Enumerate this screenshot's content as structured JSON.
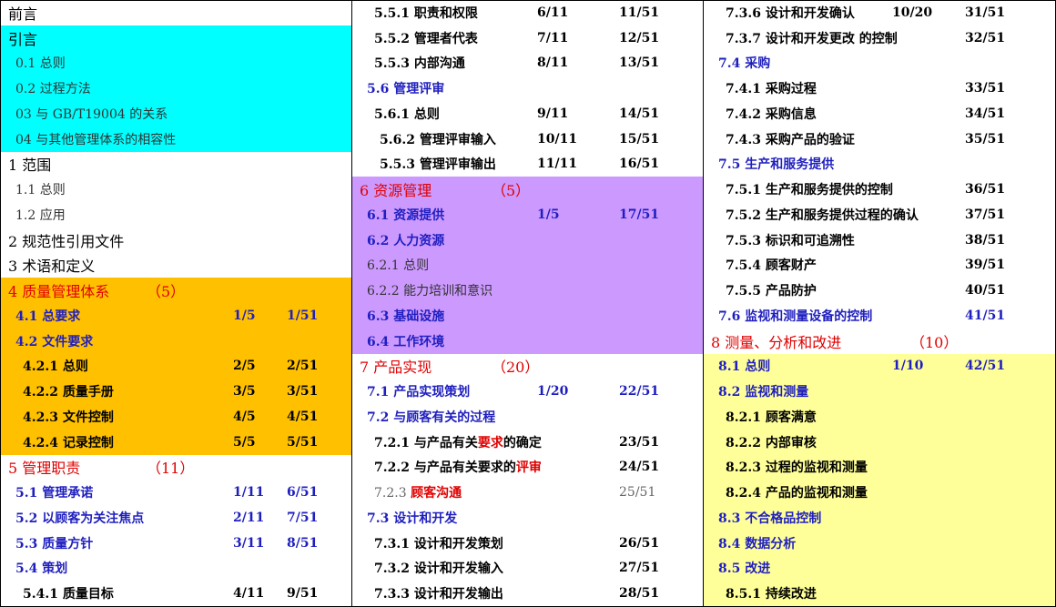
{
  "colors": {
    "cyan": "#00ffff",
    "orange": "#ffc000",
    "purple": "#cc99ff",
    "light_yellow": "#ffff99",
    "white": "#ffffff",
    "blue_text": "#1f1fbf",
    "red_text": "#e00000"
  },
  "columns": [
    {
      "rows": [
        {
          "title": "前言",
          "bg": "white",
          "style": "h1",
          "page": "",
          "total": ""
        },
        {
          "title": "引言",
          "bg": "cyan",
          "style": "h1",
          "page": "",
          "total": ""
        },
        {
          "title": "0.1 总则",
          "bg": "cyan",
          "style": "sub",
          "page": "",
          "total": ""
        },
        {
          "title": "0.2 过程方法",
          "bg": "cyan",
          "style": "sub",
          "page": "",
          "total": ""
        },
        {
          "title": "03 与 GB/T19004 的关系",
          "bg": "cyan",
          "style": "sub",
          "page": "",
          "total": ""
        },
        {
          "title": "04 与其他管理体系的相容性",
          "bg": "cyan",
          "style": "sub",
          "page": "",
          "total": ""
        },
        {
          "title": "1 范围",
          "bg": "white",
          "style": "h1",
          "page": "",
          "total": ""
        },
        {
          "title": "1.1 总则",
          "bg": "white",
          "style": "sub",
          "page": "",
          "total": ""
        },
        {
          "title": "1.2 应用",
          "bg": "white",
          "style": "sub",
          "page": "",
          "total": ""
        },
        {
          "title": "2 规范性引用文件",
          "bg": "white",
          "style": "h1",
          "page": "",
          "total": ""
        },
        {
          "title": "3 术语和定义",
          "bg": "white",
          "style": "h1",
          "page": "",
          "total": ""
        },
        {
          "title": "4 质量管理体系",
          "count": "（5）",
          "bg": "orange",
          "style": "sec",
          "page": "",
          "total": ""
        },
        {
          "title": "4.1 总要求",
          "bg": "orange",
          "style": "blue",
          "page": "1/5",
          "total": "1/51"
        },
        {
          "title": "4.2 文件要求",
          "bg": "orange",
          "style": "blue",
          "page": "",
          "total": ""
        },
        {
          "title": "4.2.1 总则",
          "bg": "orange",
          "style": "bsub",
          "page": "2/5",
          "total": "2/51"
        },
        {
          "title": "4.2.2 质量手册",
          "bg": "orange",
          "style": "bsub",
          "page": "3/5",
          "total": "3/51"
        },
        {
          "title": "4.2.3 文件控制",
          "bg": "orange",
          "style": "bsub",
          "page": "4/5",
          "total": "4/51"
        },
        {
          "title": "4.2.4 记录控制",
          "bg": "orange",
          "style": "bsub",
          "page": "5/5",
          "total": "5/51"
        },
        {
          "title": "5 管理职责",
          "count": "（11）",
          "bg": "white",
          "style": "sec",
          "page": "",
          "total": ""
        },
        {
          "title": "5.1 管理承诺",
          "bg": "white",
          "style": "blue",
          "page": "1/11",
          "total": "6/51"
        },
        {
          "title": "5.2 以顾客为关注焦点",
          "bg": "white",
          "style": "blue",
          "page": "2/11",
          "total": "7/51"
        },
        {
          "title": "5.3 质量方针",
          "bg": "white",
          "style": "blue",
          "page": "3/11",
          "total": "8/51"
        },
        {
          "title": "5.4 策划",
          "bg": "white",
          "style": "blue",
          "page": "",
          "total": ""
        },
        {
          "title": "5.4.1 质量目标",
          "bg": "white",
          "style": "bsub",
          "page": "4/11",
          "total": "9/51"
        }
      ]
    },
    {
      "rows": [
        {
          "title": "5.5.1 职责和权限",
          "bg": "white",
          "style": "bsub",
          "page": "6/11",
          "total": "11/51"
        },
        {
          "title": "5.5.2 管理者代表",
          "bg": "white",
          "style": "bsub",
          "page": "7/11",
          "total": "12/51"
        },
        {
          "title": "5.5.3 内部沟通",
          "bg": "white",
          "style": "bsub",
          "page": "8/11",
          "total": "13/51"
        },
        {
          "title": "5.6 管理评审",
          "bg": "white",
          "style": "blue",
          "page": "",
          "total": ""
        },
        {
          "title": "5.6.1 总则",
          "bg": "white",
          "style": "bsub",
          "page": "9/11",
          "total": "14/51"
        },
        {
          "title": "5.6.2 管理评审输入",
          "bg": "white",
          "style": "bsub2",
          "page": "10/11",
          "total": "15/51"
        },
        {
          "title": "5.5.3 管理评审输出",
          "bg": "white",
          "style": "bsub2",
          "page": "11/11",
          "total": "16/51"
        },
        {
          "title": "6 资源管理",
          "count": "（5）",
          "bg": "purple",
          "style": "sec",
          "page": "",
          "total": ""
        },
        {
          "title": "6.1 资源提供",
          "bg": "purple",
          "style": "blue",
          "page": "1/5",
          "total": "17/51"
        },
        {
          "title": "6.2 人力资源",
          "bg": "purple",
          "style": "blue",
          "page": "",
          "total": ""
        },
        {
          "title": "6.2.1 总则",
          "bg": "purple",
          "style": "sub",
          "page": "",
          "total": ""
        },
        {
          "title": "6.2.2 能力培训和意识",
          "bg": "purple",
          "style": "sub",
          "page": "",
          "total": ""
        },
        {
          "title": "6.3 基础设施",
          "bg": "purple",
          "style": "blue",
          "page": "",
          "total": ""
        },
        {
          "title": "6.4 工作环境",
          "bg": "purple",
          "style": "blue",
          "page": "",
          "total": ""
        },
        {
          "title": "7 产品实现",
          "count": "（20）",
          "bg": "white",
          "style": "sec",
          "page": "",
          "total": ""
        },
        {
          "title": "7.1 产品实现策划",
          "bg": "white",
          "style": "blue",
          "page": "1/20",
          "total": "22/51"
        },
        {
          "title": "7.2 与顾客有关的过程",
          "bg": "white",
          "style": "blue",
          "page": "",
          "total": ""
        },
        {
          "title": "7.2.1 与产品有关",
          "hl": "要求",
          "tail": "的确定",
          "bg": "white",
          "style": "bsub",
          "page": "",
          "total": "23/51"
        },
        {
          "title": "7.2.2 与产品有关要求的",
          "hl": "评审",
          "tail": "",
          "bg": "white",
          "style": "bsub",
          "page": "",
          "total": "24/51"
        },
        {
          "title": "7.2.3 ",
          "hl": "顾客沟通",
          "tail": "",
          "bg": "white",
          "style": "dim",
          "page": "",
          "total": "25/51"
        },
        {
          "title": "7.3 设计和开发",
          "bg": "white",
          "style": "blue",
          "page": "",
          "total": ""
        },
        {
          "title": "7.3.1 设计和开发策划",
          "bg": "white",
          "style": "bsub",
          "page": "",
          "total": "26/51"
        },
        {
          "title": "7.3.2 设计和开发输入",
          "bg": "white",
          "style": "bsub",
          "page": "",
          "total": "27/51"
        },
        {
          "title": "7.3.3 设计和开发输出",
          "bg": "white",
          "style": "bsub",
          "page": "",
          "total": "28/51"
        }
      ]
    },
    {
      "rows": [
        {
          "title": "7.3.6 设计和开发确认",
          "bg": "white",
          "style": "bsub",
          "page": "10/20",
          "total": "31/51"
        },
        {
          "title": "7.3.7 设计和开发更改 的控制",
          "bg": "white",
          "style": "bsub",
          "page": "",
          "total": "32/51"
        },
        {
          "title": "7.4 采购",
          "bg": "white",
          "style": "blue",
          "page": "",
          "total": ""
        },
        {
          "title": "7.4.1 采购过程",
          "bg": "white",
          "style": "bsub",
          "page": "",
          "total": "33/51"
        },
        {
          "title": "7.4.2 采购信息",
          "bg": "white",
          "style": "bsub",
          "page": "",
          "total": "34/51"
        },
        {
          "title": "7.4.3 采购产品的验证",
          "bg": "white",
          "style": "bsub",
          "page": "",
          "total": "35/51"
        },
        {
          "title": "7.5 生产和服务提供",
          "bg": "white",
          "style": "blue",
          "page": "",
          "total": ""
        },
        {
          "title": "7.5.1 生产和服务提供的控制",
          "bg": "white",
          "style": "bsub",
          "page": "",
          "total": "36/51"
        },
        {
          "title": "7.5.2 生产和服务提供过程的确认",
          "bg": "white",
          "style": "bsub",
          "page": "",
          "total": "37/51"
        },
        {
          "title": "7.5.3 标识和可追溯性",
          "bg": "white",
          "style": "bsub",
          "page": "",
          "total": "38/51"
        },
        {
          "title": "7.5.4 顾客财产",
          "bg": "white",
          "style": "bsub",
          "page": "",
          "total": "39/51"
        },
        {
          "title": "7.5.5 产品防护",
          "bg": "white",
          "style": "bsub",
          "page": "",
          "total": "40/51"
        },
        {
          "title": "7.6 监视和测量设备的控制",
          "bg": "white",
          "style": "blue",
          "page": "",
          "total": "41/51"
        },
        {
          "title": "8 测量、分析和改进",
          "count": "（10）",
          "bg": "white",
          "style": "sec",
          "page": "",
          "total": ""
        },
        {
          "title": "8.1 总则",
          "bg": "light_yellow",
          "style": "blue",
          "page": "1/10",
          "total": "42/51"
        },
        {
          "title": "8.2 监视和测量",
          "bg": "light_yellow",
          "style": "blue",
          "page": "",
          "total": ""
        },
        {
          "title": "8.2.1 顾客满意",
          "bg": "light_yellow",
          "style": "bsub",
          "page": "",
          "total": ""
        },
        {
          "title": "8.2.2 内部审核",
          "bg": "light_yellow",
          "style": "bsub",
          "page": "",
          "total": ""
        },
        {
          "title": "8.2.3 过程的监视和测量",
          "bg": "light_yellow",
          "style": "bsub",
          "page": "",
          "total": ""
        },
        {
          "title": "8.2.4 产品的监视和测量",
          "bg": "light_yellow",
          "style": "bsub",
          "page": "",
          "total": ""
        },
        {
          "title": "8.3 不合格品控制",
          "bg": "light_yellow",
          "style": "blue",
          "page": "",
          "total": ""
        },
        {
          "title": "8.4 数据分析",
          "bg": "light_yellow",
          "style": "blue",
          "page": "",
          "total": ""
        },
        {
          "title": "8.5 改进",
          "bg": "light_yellow",
          "style": "blue",
          "page": "",
          "total": ""
        },
        {
          "title": "8.5.1 持续改进",
          "bg": "light_yellow",
          "style": "bsub",
          "page": "",
          "total": ""
        }
      ]
    }
  ]
}
